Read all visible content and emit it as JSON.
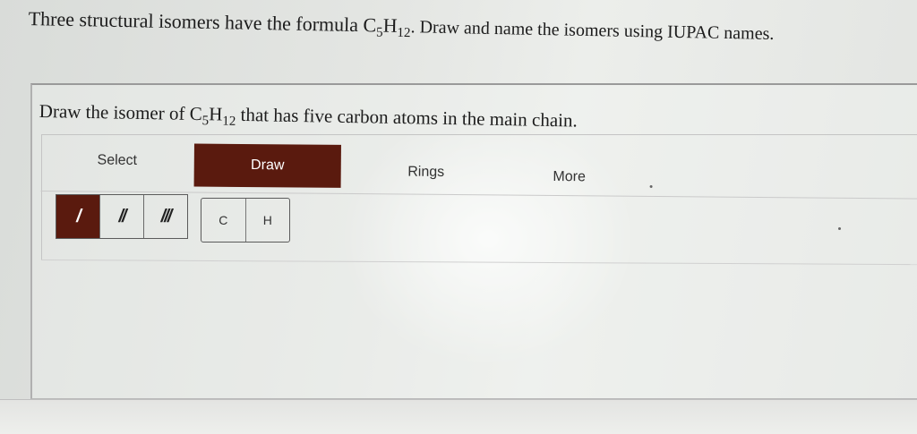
{
  "question": {
    "prefix": "Three structural isomers have the formula C",
    "sub1": "5",
    "mid": "H",
    "sub2": "12",
    "suffix": ". Draw and name the isomers using IUPAC names."
  },
  "subquestion": {
    "prefix": "Draw the isomer of C",
    "sub1": "5",
    "mid": "H",
    "sub2": "12",
    "suffix": " that has five carbon atoms in the main chain."
  },
  "tabs": [
    {
      "label": "Select",
      "active": false
    },
    {
      "label": "Draw",
      "active": true
    },
    {
      "label": "Rings",
      "active": false
    },
    {
      "label": "More",
      "active": false
    }
  ],
  "bond_tools": [
    {
      "label": "/",
      "active": true
    },
    {
      "label": "//",
      "active": false
    },
    {
      "label": "///",
      "active": false
    }
  ],
  "atom_tools": [
    {
      "label": "C"
    },
    {
      "label": "H"
    }
  ],
  "colors": {
    "accent": "#5a1a0e"
  }
}
